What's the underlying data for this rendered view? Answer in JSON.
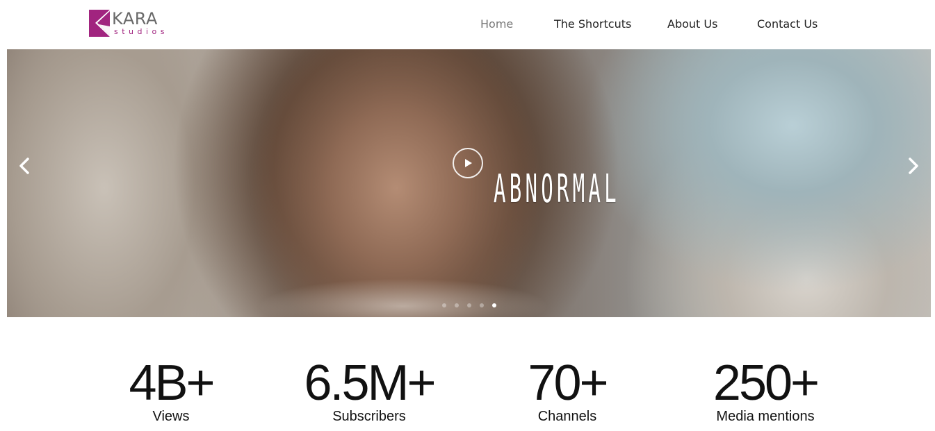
{
  "brand": {
    "word": "KARA",
    "sub": "studios",
    "accent_color": "#a1247f"
  },
  "nav": {
    "items": [
      {
        "label": "Home",
        "active": true
      },
      {
        "label": "The Shortcuts",
        "active": false
      },
      {
        "label": "About Us",
        "active": false
      },
      {
        "label": "Contact Us",
        "active": false
      }
    ]
  },
  "hero": {
    "title": "ABNORMAL",
    "prev_icon": "chevron-left-icon",
    "next_icon": "chevron-right-icon",
    "play_icon": "play-icon",
    "slide_count": 5,
    "active_slide": 5
  },
  "stats": [
    {
      "value": "4B+",
      "label": "Views"
    },
    {
      "value": "6.5M+",
      "label": "Subscribers"
    },
    {
      "value": "70+",
      "label": "Channels"
    },
    {
      "value": "250+",
      "label": "Media mentions"
    }
  ]
}
